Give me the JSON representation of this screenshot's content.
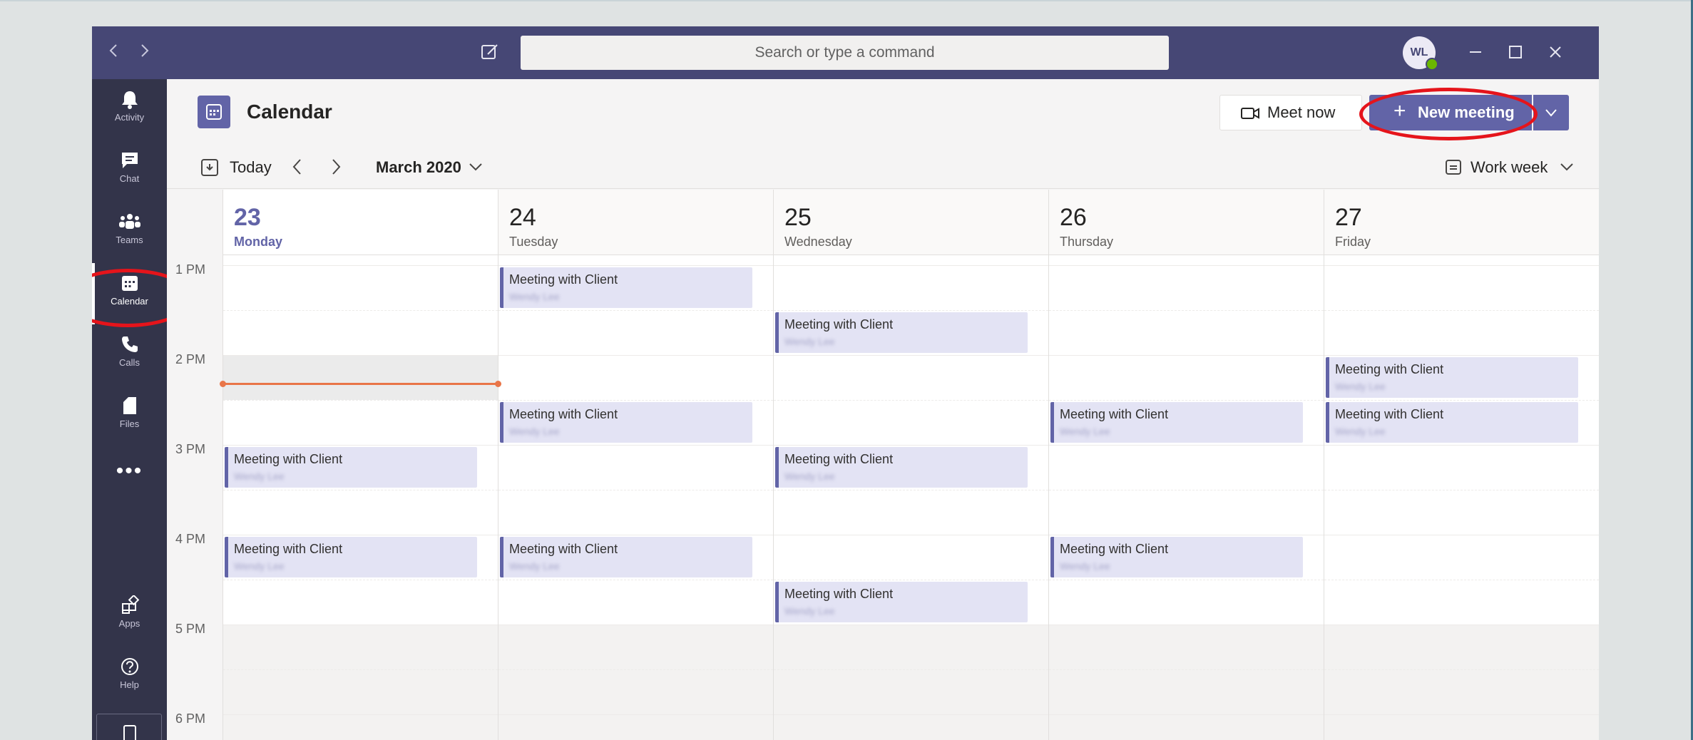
{
  "titlebar": {
    "search_placeholder": "Search or type a command",
    "avatar_initials": "WL",
    "icons": [
      "chevron-left-icon",
      "chevron-right-icon",
      "compose-icon",
      "minimize-icon",
      "maximize-icon",
      "close-icon"
    ]
  },
  "rail": {
    "items": [
      {
        "label": "Activity",
        "icon": "bell-icon"
      },
      {
        "label": "Chat",
        "icon": "chat-icon"
      },
      {
        "label": "Teams",
        "icon": "teams-icon"
      },
      {
        "label": "Calendar",
        "icon": "calendar-icon",
        "active": true
      },
      {
        "label": "Calls",
        "icon": "phone-icon"
      },
      {
        "label": "Files",
        "icon": "file-icon"
      }
    ],
    "more": "•••",
    "bottom_items": [
      {
        "label": "Apps",
        "icon": "apps-icon"
      },
      {
        "label": "Help",
        "icon": "help-icon"
      }
    ]
  },
  "header": {
    "title": "Calendar",
    "meet_now": "Meet now",
    "new_meeting_plus": "+",
    "new_meeting": "New meeting"
  },
  "toolbar": {
    "today": "Today",
    "month": "March 2020",
    "view": "Work week"
  },
  "time_labels": [
    "1 PM",
    "2 PM",
    "3 PM",
    "4 PM",
    "5 PM",
    "6 PM"
  ],
  "days": [
    {
      "num": "23",
      "name": "Monday",
      "today": true
    },
    {
      "num": "24",
      "name": "Tuesday"
    },
    {
      "num": "25",
      "name": "Wednesday"
    },
    {
      "num": "26",
      "name": "Thursday"
    },
    {
      "num": "27",
      "name": "Friday"
    }
  ],
  "events": [
    {
      "day": 0,
      "start": "3:00 PM",
      "title": "Meeting with Client",
      "organizer": "Wendy Lee"
    },
    {
      "day": 0,
      "start": "4:00 PM",
      "title": "Meeting with Client",
      "organizer": "Wendy Lee"
    },
    {
      "day": 1,
      "start": "1:00 PM",
      "title": "Meeting with Client",
      "organizer": "Wendy Lee"
    },
    {
      "day": 1,
      "start": "2:30 PM",
      "title": "Meeting with Client",
      "organizer": "Wendy Lee"
    },
    {
      "day": 1,
      "start": "4:00 PM",
      "title": "Meeting with Client",
      "organizer": "Wendy Lee"
    },
    {
      "day": 2,
      "start": "1:30 PM",
      "title": "Meeting with Client",
      "organizer": "Wendy Lee"
    },
    {
      "day": 2,
      "start": "3:00 PM",
      "title": "Meeting with Client",
      "organizer": "Wendy Lee"
    },
    {
      "day": 2,
      "start": "4:30 PM",
      "title": "Meeting with Client",
      "organizer": "Wendy Lee"
    },
    {
      "day": 3,
      "start": "2:30 PM",
      "title": "Meeting with Client",
      "organizer": "Wendy Lee"
    },
    {
      "day": 3,
      "start": "4:00 PM",
      "title": "Meeting with Client",
      "organizer": "Wendy Lee"
    },
    {
      "day": 4,
      "start": "2:00 PM",
      "title": "Meeting with Client",
      "organizer": "Wendy Lee"
    },
    {
      "day": 4,
      "start": "2:30 PM",
      "title": "Meeting with Client",
      "organizer": "Wendy Lee"
    }
  ],
  "colors": {
    "brand": "#6264a7",
    "titlebar": "#464775",
    "rail": "#33344a",
    "event_bg": "#e3e3f4",
    "now_line": "#e97548",
    "annotation_circle": "#e5141b"
  }
}
